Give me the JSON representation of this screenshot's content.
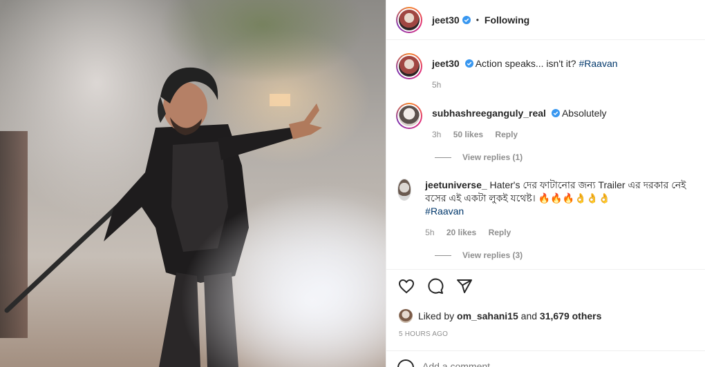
{
  "post": {
    "image_alt": "Man in black outfit holding a spear in a smoky setting",
    "author": {
      "username": "jeet30",
      "verified": true,
      "follow_state": "Following"
    },
    "caption": {
      "username": "jeet30",
      "text_prefix": "Action speaks... isn't it?",
      "hashtag": "#Raavan",
      "time": "5h"
    }
  },
  "comments": [
    {
      "username": "subhashreeganguly_real",
      "verified": true,
      "text": "Absolutely",
      "time": "3h",
      "likes": "50 likes",
      "reply": "Reply",
      "view_replies": "View replies (1)"
    },
    {
      "username": "jeetuniverse_",
      "verified": false,
      "text": "Hater's দের ফাটানোর জন্য Trailer এর দরকার নেই বসের এই একটা লুকই যথেষ্ট। 🔥🔥🔥👌👌👌",
      "hashtag": "#Raavan",
      "time": "5h",
      "likes": "20 likes",
      "reply": "Reply",
      "view_replies": "View replies (3)"
    }
  ],
  "likes_summary": {
    "prefix": "Liked by",
    "user": "om_sahani15",
    "middle": "and",
    "others": "31,679 others"
  },
  "post_time": "5 HOURS AGO",
  "add_comment": {
    "placeholder": "Add a comment..."
  },
  "icons": {
    "like": "heart-icon",
    "comment": "comment-icon",
    "share": "paper-plane-icon",
    "verified": "verified-badge-icon",
    "emoji": "emoji-icon"
  },
  "colors": {
    "verified": "#3897f0",
    "hashtag": "#00376b",
    "secondary_text": "#8e8e8e"
  }
}
